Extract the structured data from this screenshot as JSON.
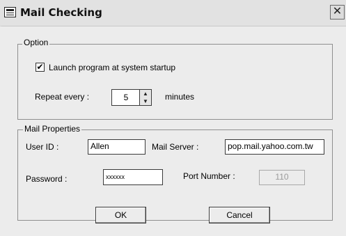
{
  "window": {
    "title": "Mail Checking",
    "close_glyph": "✕",
    "app_icon": "mail-app-icon",
    "close_icon": "close-icon"
  },
  "option_group": {
    "legend": "Option",
    "launch_checkbox": {
      "label": "Launch program at system startup",
      "checked": true,
      "mark": "✔"
    },
    "repeat_label": "Repeat every :",
    "repeat_value": "5",
    "repeat_unit": "minutes",
    "spin_up": "▲",
    "spin_down": "▼"
  },
  "mail_group": {
    "legend": "Mail Properties",
    "user_id_label": "User ID :",
    "user_id_value": "Allen",
    "mail_server_label": "Mail Server :",
    "mail_server_value": "pop.mail.yahoo.com.tw",
    "password_label": "Password :",
    "password_value": "xxxxxx",
    "port_label": "Port Number :",
    "port_value": "110"
  },
  "buttons": {
    "ok": "OK",
    "cancel": "Cancel"
  }
}
